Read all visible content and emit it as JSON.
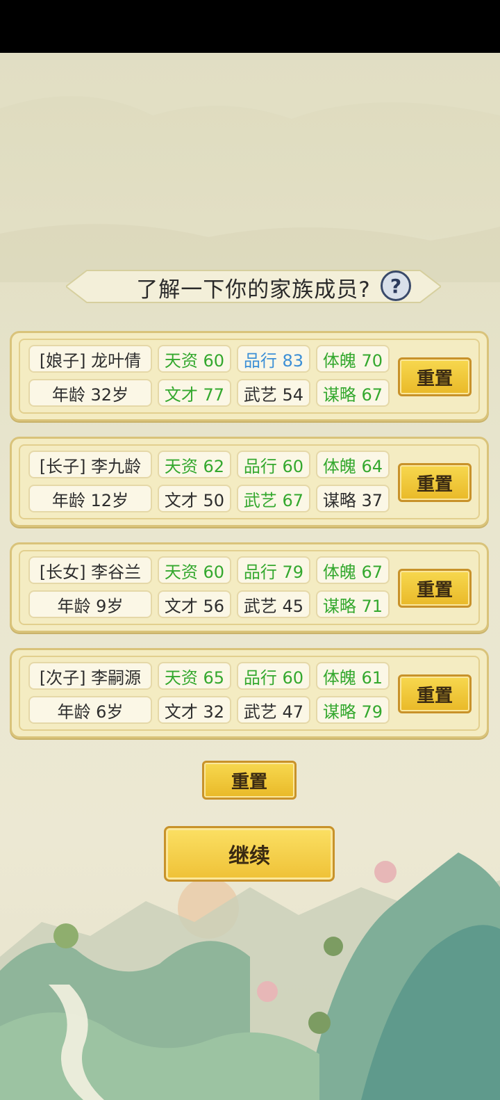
{
  "header": {
    "title": "了解一下你的家族成员?",
    "help_label": "?"
  },
  "members": [
    {
      "name": "[娘子] 龙叶倩",
      "age": "年龄 32岁",
      "stats": [
        {
          "label": "天资 60",
          "color": "green"
        },
        {
          "label": "品行 83",
          "color": "blue"
        },
        {
          "label": "体魄 70",
          "color": "green"
        },
        {
          "label": "文才 77",
          "color": "green"
        },
        {
          "label": "武艺 54",
          "color": "normal"
        },
        {
          "label": "谋略 67",
          "color": "green"
        }
      ],
      "reset_label": "重置"
    },
    {
      "name": "[长子] 李九龄",
      "age": "年龄 12岁",
      "stats": [
        {
          "label": "天资 62",
          "color": "green"
        },
        {
          "label": "品行 60",
          "color": "green"
        },
        {
          "label": "体魄 64",
          "color": "green"
        },
        {
          "label": "文才 50",
          "color": "normal"
        },
        {
          "label": "武艺 67",
          "color": "green"
        },
        {
          "label": "谋略 37",
          "color": "normal"
        }
      ],
      "reset_label": "重置"
    },
    {
      "name": "[长女] 李谷兰",
      "age": "年龄 9岁",
      "stats": [
        {
          "label": "天资 60",
          "color": "green"
        },
        {
          "label": "品行 79",
          "color": "green"
        },
        {
          "label": "体魄 67",
          "color": "green"
        },
        {
          "label": "文才 56",
          "color": "normal"
        },
        {
          "label": "武艺 45",
          "color": "normal"
        },
        {
          "label": "谋略 71",
          "color": "green"
        }
      ],
      "reset_label": "重置"
    },
    {
      "name": "[次子] 李嗣源",
      "age": "年龄 6岁",
      "stats": [
        {
          "label": "天资 65",
          "color": "green"
        },
        {
          "label": "品行 60",
          "color": "green"
        },
        {
          "label": "体魄 61",
          "color": "green"
        },
        {
          "label": "文才 32",
          "color": "normal"
        },
        {
          "label": "武艺 47",
          "color": "normal"
        },
        {
          "label": "谋略 79",
          "color": "green"
        }
      ],
      "reset_label": "重置"
    }
  ],
  "actions": {
    "reset_all_label": "重置",
    "continue_label": "继续"
  },
  "colors": {
    "green": "#34a82e",
    "blue": "#3c8fd6",
    "gold": "#efc136",
    "card": "#f4ecc2"
  }
}
